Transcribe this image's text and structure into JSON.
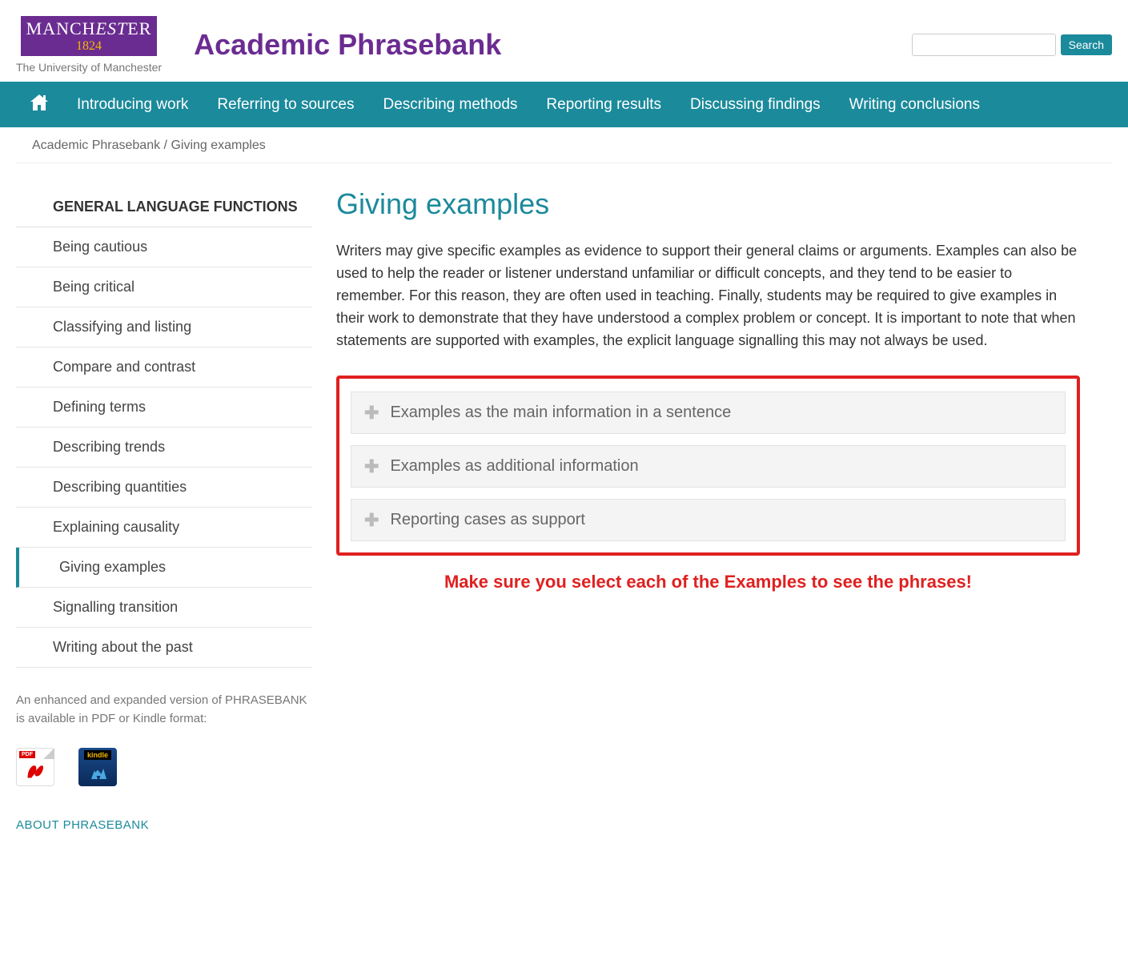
{
  "header": {
    "logo_top_1": "MANCH",
    "logo_top_2": "EST",
    "logo_top_3": "ER",
    "logo_year": "1824",
    "logo_sub": "The University of Manchester",
    "site_title": "Academic Phrasebank",
    "search_button": "Search"
  },
  "nav": {
    "items": [
      "Introducing work",
      "Referring to sources",
      "Describing methods",
      "Reporting results",
      "Discussing findings",
      "Writing conclusions"
    ]
  },
  "breadcrumb": {
    "root": "Academic Phrasebank",
    "sep": " / ",
    "current": "Giving examples"
  },
  "sidebar": {
    "heading": "GENERAL LANGUAGE FUNCTIONS",
    "items": [
      {
        "label": "Being cautious",
        "active": false
      },
      {
        "label": "Being critical",
        "active": false
      },
      {
        "label": "Classifying and listing",
        "active": false
      },
      {
        "label": "Compare and contrast",
        "active": false
      },
      {
        "label": "Defining terms",
        "active": false
      },
      {
        "label": "Describing trends",
        "active": false
      },
      {
        "label": "Describing quantities",
        "active": false
      },
      {
        "label": "Explaining causality",
        "active": false
      },
      {
        "label": "Giving examples",
        "active": true
      },
      {
        "label": "Signalling transition",
        "active": false
      },
      {
        "label": "Writing about the past",
        "active": false
      }
    ],
    "note": "An enhanced and expanded version of PHRASEBANK is available in PDF or Kindle format:",
    "pdf_label": "PDF",
    "kindle_label": "kindle",
    "about": "ABOUT PHRASEBANK"
  },
  "main": {
    "title": "Giving examples",
    "intro": "Writers may give specific examples as evidence to support their general claims or arguments. Examples can also be used to help the reader or listener understand unfamiliar or difficult concepts, and they tend to be easier to remember. For this reason, they are often used in teaching. Finally, students may be required to give examples in their work to demonstrate that they have understood a complex problem or concept. It is important to note that when statements are supported with examples, the explicit language signalling this may not always be used.",
    "accordion": [
      "Examples as the main information in a sentence",
      "Examples as additional information",
      "Reporting cases as support"
    ],
    "callout": "Make sure you select each of the Examples to see the phrases!"
  }
}
